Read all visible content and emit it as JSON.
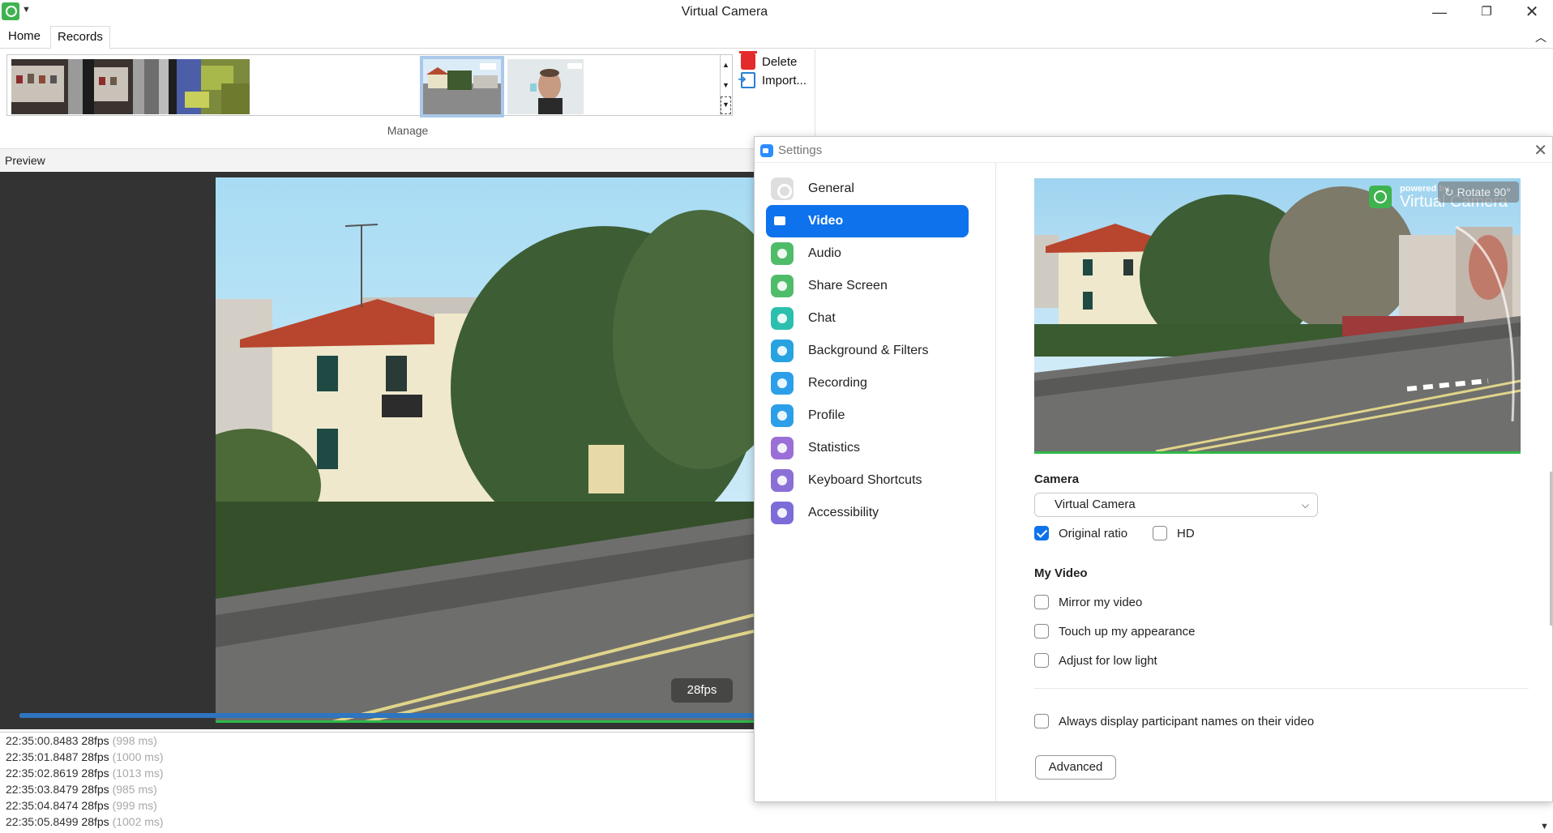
{
  "window": {
    "title": "Virtual Camera"
  },
  "ribbon": {
    "tabs": [
      {
        "label": "Home"
      },
      {
        "label": "Records"
      }
    ],
    "actions": {
      "delete_label": "Delete",
      "import_label": "Import..."
    },
    "group_label": "Manage"
  },
  "preview": {
    "header": "Preview",
    "fps": "28fps",
    "progress": 1.0
  },
  "log": [
    {
      "time": "22:35:00.8483",
      "fps": "28fps",
      "ms": "(998 ms)"
    },
    {
      "time": "22:35:01.8487",
      "fps": "28fps",
      "ms": "(1000 ms)"
    },
    {
      "time": "22:35:02.8619",
      "fps": "28fps",
      "ms": "(1013 ms)"
    },
    {
      "time": "22:35:03.8479",
      "fps": "28fps",
      "ms": "(985 ms)"
    },
    {
      "time": "22:35:04.8474",
      "fps": "28fps",
      "ms": "(999 ms)"
    },
    {
      "time": "22:35:05.8499",
      "fps": "28fps",
      "ms": "(1002 ms)"
    }
  ],
  "settings": {
    "title": "Settings",
    "nav": [
      {
        "label": "General"
      },
      {
        "label": "Video"
      },
      {
        "label": "Audio"
      },
      {
        "label": "Share Screen"
      },
      {
        "label": "Chat"
      },
      {
        "label": "Background & Filters"
      },
      {
        "label": "Recording"
      },
      {
        "label": "Profile"
      },
      {
        "label": "Statistics"
      },
      {
        "label": "Keyboard Shortcuts"
      },
      {
        "label": "Accessibility"
      }
    ],
    "watermark": {
      "small": "powered by",
      "big": "Virtual Camera"
    },
    "rotate_label": "Rotate 90°",
    "camera": {
      "label": "Camera",
      "selected": "Virtual Camera",
      "original_ratio": "Original ratio",
      "hd": "HD"
    },
    "my_video": {
      "label": "My Video",
      "mirror": "Mirror my video",
      "touch_up": "Touch up my appearance",
      "low_light": "Adjust for low light"
    },
    "participant_names": "Always display participant names on their video",
    "advanced_label": "Advanced"
  },
  "colors": {
    "accent": "#0e72ed",
    "progress": "#2e74c0",
    "green": "#2fb84a"
  }
}
